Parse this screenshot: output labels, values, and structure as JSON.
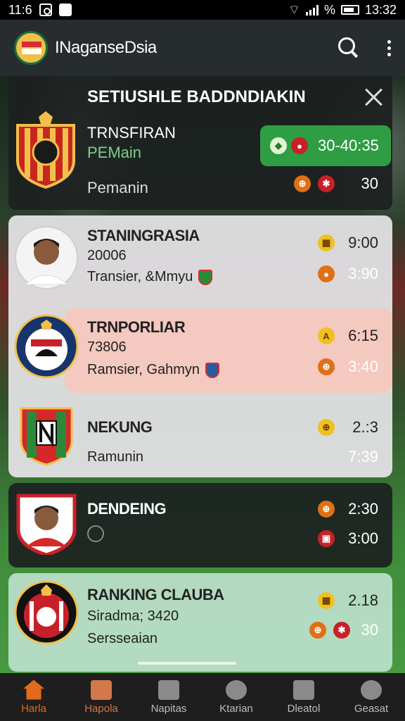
{
  "status_bar": {
    "time_left": "11:6",
    "time_right": "13:32",
    "signal_text": "%"
  },
  "app": {
    "title": "INaganseDsia"
  },
  "header_card": {
    "title": "SETIUSHLE BADDNDIAKIN",
    "line1": "TRNSFIRAN",
    "line2": "PEMain",
    "line3": "Pemanin",
    "live_time": "30-40:35",
    "score_value": "30"
  },
  "rows": [
    {
      "title": "STANINGRASIA",
      "sub": "20006",
      "sub2": "Transier, &Mmyu",
      "val1": "9:00",
      "val2": "3:90"
    },
    {
      "title": "TRNPORLIAR",
      "sub": "73806",
      "sub2": "Ramsier, Gahmyn",
      "val1": "6:15",
      "val2": "3:40"
    },
    {
      "title": "NEKUNG",
      "sub": "Ramunin",
      "val1": "2.:3",
      "val2": "7:39"
    },
    {
      "title": "DENDEING",
      "val1": "2:30",
      "val2": "3:00"
    },
    {
      "title": "RANKING CLAUBA",
      "sub": "Siradma; 3420",
      "sub2": "Sersseaian",
      "val1": "2.18",
      "val2": "30"
    }
  ],
  "nav": [
    {
      "label": "Harla"
    },
    {
      "label": "Hapola"
    },
    {
      "label": "Napitas"
    },
    {
      "label": "Ktarian"
    },
    {
      "label": "Dleatol"
    },
    {
      "label": "Geasat"
    }
  ],
  "colors": {
    "accent": "#e36b1c",
    "live": "#2e9d44",
    "highlight": "#f4c9c0"
  }
}
